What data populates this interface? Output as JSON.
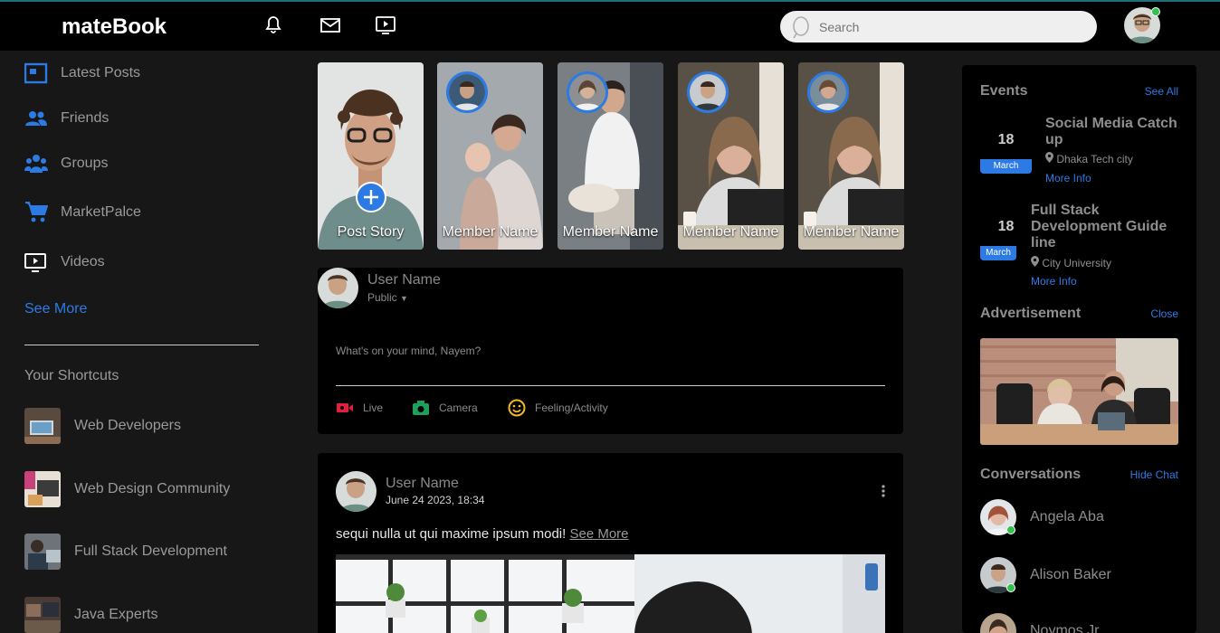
{
  "navbar": {
    "logo": "mateBook",
    "search_placeholder": "Search",
    "icons": [
      "bell-icon",
      "mail-icon",
      "video-icon"
    ]
  },
  "sidebar": {
    "items": [
      {
        "label": "Latest Posts",
        "icon": "latest-posts-icon"
      },
      {
        "label": "Friends",
        "icon": "friends-icon"
      },
      {
        "label": "Groups",
        "icon": "groups-icon"
      },
      {
        "label": "MarketPalce",
        "icon": "cart-icon"
      },
      {
        "label": "Videos",
        "icon": "videos-icon"
      }
    ],
    "see_more": "See More",
    "shortcuts_title": "Your Shortcuts",
    "shortcuts": [
      {
        "label": "Web Developers"
      },
      {
        "label": "Web Design Community"
      },
      {
        "label": "Full Stack Development"
      },
      {
        "label": "Java Experts"
      }
    ]
  },
  "stories": {
    "post_story": "Post Story",
    "members": [
      {
        "name": "Member Name"
      },
      {
        "name": "Member Name"
      },
      {
        "name": "Member Name"
      },
      {
        "name": "Member Name"
      }
    ]
  },
  "composer": {
    "user_name": "User Name",
    "privacy": "Public",
    "placeholder": "What's on your mind, Nayem?",
    "actions": [
      {
        "label": "Live",
        "icon": "live-video-icon",
        "color": "#e41e3f"
      },
      {
        "label": "Camera",
        "icon": "camera-icon",
        "color": "#1fa05a"
      },
      {
        "label": "Feeling/Activity",
        "icon": "smiley-icon",
        "color": "#f5b928"
      }
    ]
  },
  "post": {
    "user_name": "User Name",
    "date": "June 24 2023, 18:34",
    "text": "sequi nulla ut qui maxime ipsum modi!",
    "see_more": "See More"
  },
  "rightbar": {
    "events_title": "Events",
    "see_all": "See All",
    "events": [
      {
        "day": "18",
        "month": "March",
        "title": "Social Media Catch up",
        "location": "Dhaka Tech city",
        "more": "More Info"
      },
      {
        "day": "18",
        "month": "March",
        "title": "Full Stack Development Guide line",
        "location": "City University",
        "more": "More Info"
      }
    ],
    "ad_title": "Advertisement",
    "ad_close": "Close",
    "conversations_title": "Conversations",
    "hide_chat": "Hide Chat",
    "conversations": [
      {
        "name": "Angela Aba",
        "online": true
      },
      {
        "name": "Alison Baker",
        "online": true
      },
      {
        "name": "Noymos Jr",
        "online": false
      }
    ]
  },
  "colors": {
    "accent": "#2c7be5",
    "online": "#31c24d",
    "background": "#171717",
    "panel": "#000000"
  }
}
